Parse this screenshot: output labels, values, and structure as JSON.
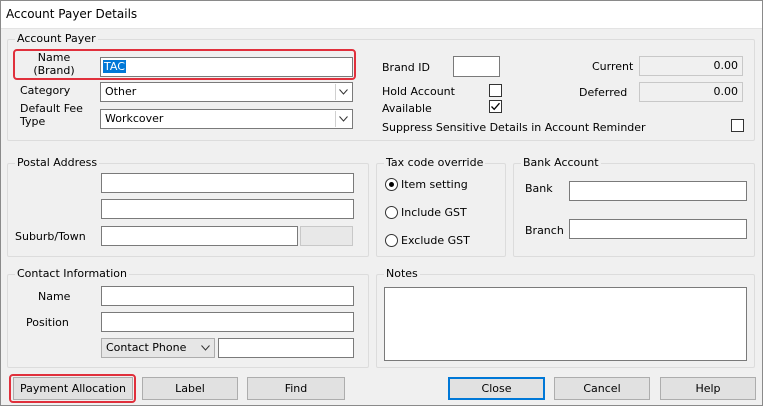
{
  "window": {
    "title": "Account Payer Details"
  },
  "account_payer": {
    "group_title": "Account Payer",
    "name_label_line1": "Name",
    "name_label_line2": "(Brand)",
    "name_value": "TAC",
    "category_label": "Category",
    "category_value": "Other",
    "fee_type_label_line1": "Default Fee",
    "fee_type_label_line2": "Type",
    "fee_type_value": "Workcover",
    "brand_id_label": "Brand ID",
    "brand_id_value": "",
    "hold_account_label": "Hold Account",
    "hold_account_checked": false,
    "available_label": "Available",
    "available_checked": true,
    "suppress_label": "Suppress Sensitive Details in Account Reminder",
    "suppress_checked": false,
    "current_label": "Current",
    "current_value": "0.00",
    "deferred_label": "Deferred",
    "deferred_value": "0.00"
  },
  "postal_address": {
    "group_title": "Postal Address",
    "line1": "",
    "line2": "",
    "suburb_label": "Suburb/Town",
    "suburb_value": "",
    "postcode_value": ""
  },
  "tax_code": {
    "group_title": "Tax code override",
    "options": [
      "Item setting",
      "Include GST",
      "Exclude GST"
    ],
    "selected": "Item setting"
  },
  "bank_account": {
    "group_title": "Bank Account",
    "bank_label": "Bank",
    "bank_value": "",
    "branch_label": "Branch",
    "branch_value": ""
  },
  "contact": {
    "group_title": "Contact Information",
    "name_label": "Name",
    "name_value": "",
    "position_label": "Position",
    "position_value": "",
    "phone_type": "Contact Phone",
    "phone_value": ""
  },
  "notes": {
    "group_title": "Notes",
    "value": ""
  },
  "buttons": {
    "payment_allocation": "Payment Allocation",
    "label": "Label",
    "find": "Find",
    "close": "Close",
    "cancel": "Cancel",
    "help": "Help"
  },
  "colors": {
    "highlight": "#e0303c",
    "accent": "#0078d7"
  }
}
